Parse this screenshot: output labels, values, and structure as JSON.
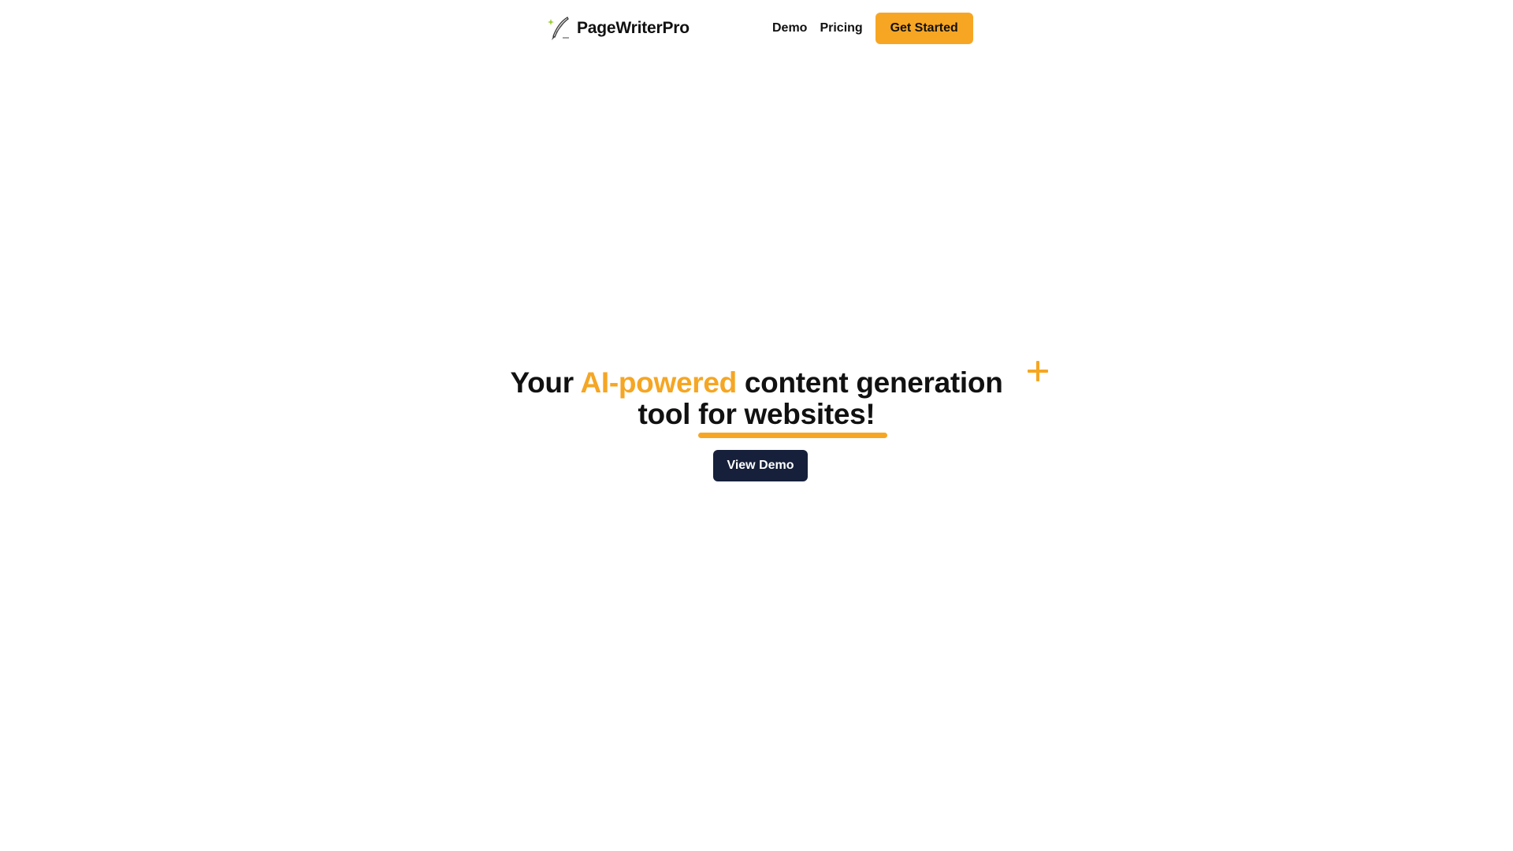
{
  "navbar": {
    "brand": {
      "name": "PageWriterPro",
      "logo_icon": "quill-pen-sparkle-icon"
    },
    "links": [
      {
        "label": "Demo"
      },
      {
        "label": "Pricing"
      }
    ],
    "cta_label": "Get Started"
  },
  "hero": {
    "title_part1": "Your ",
    "title_accent": "AI-powered",
    "title_part2": " content generation tool ",
    "title_underlined": "for websites!",
    "decoration_icon": "plus-sparkle-icon",
    "button_label": "View Demo"
  },
  "colors": {
    "accent": "#f5a623",
    "button_primary": "#f7a623",
    "button_dark": "#16203a",
    "text": "#111111",
    "background": "#ffffff"
  }
}
